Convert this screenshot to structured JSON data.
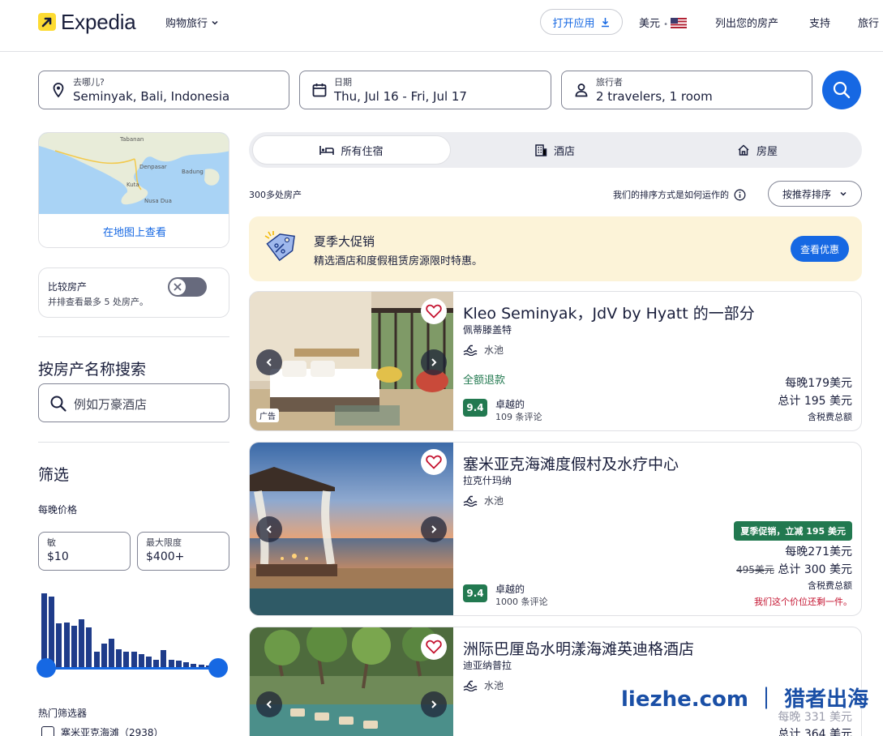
{
  "header": {
    "brand": "Expedia",
    "shop_travel": "购物旅行",
    "open_app": "打开应用",
    "currency": "美元",
    "list_property": "列出您的房产",
    "support": "支持",
    "trips": "旅行"
  },
  "search": {
    "destination_label": "去哪儿?",
    "destination_value": "Seminyak, Bali, Indonesia",
    "dates_label": "日期",
    "dates_value": "Thu, Jul 16 - Fri, Jul 17",
    "travelers_label": "旅行者",
    "travelers_value": "2 travelers, 1 room"
  },
  "sidebar": {
    "map_link": "在地图上查看",
    "map_labels": [
      "Tabanan",
      "Denpasar",
      "Kuta",
      "Nusa Dua",
      "Badung"
    ],
    "compare_title": "比较房产",
    "compare_sub": "并排查看最多 5 处房产。",
    "name_search_title": "按房产名称搜索",
    "name_search_placeholder": "例如万豪酒店",
    "filter_title": "筛选",
    "price_title": "每晚价格",
    "min_label": "敏",
    "min_value": "$10",
    "max_label": "最大限度",
    "max_value": "$400+",
    "histogram": [
      0.92,
      0.88,
      0.55,
      0.56,
      0.52,
      0.6,
      0.5,
      0.2,
      0.3,
      0.36,
      0.23,
      0.2,
      0.2,
      0.17,
      0.14,
      0.1,
      0.22,
      0.1,
      0.09,
      0.07,
      0.05,
      0.04,
      0.03
    ],
    "popular_filters_title": "热门筛选器",
    "popular_filter_1": "塞米亚克海滩（2938）"
  },
  "tabs": {
    "all": "所有住宿",
    "hotels": "酒店",
    "homes": "房屋"
  },
  "results": {
    "count": "300多处房产",
    "how_sort": "我们的排序方式是如何运作的",
    "sort_label": "按推荐排序"
  },
  "promo": {
    "title": "夏季大促销",
    "subtitle": "精选酒店和度假租赁房源限时特惠。",
    "button": "查看优惠"
  },
  "listings": [
    {
      "name": "Kleo Seminyak，JdV by Hyatt 的一部分",
      "location": "佩蒂滕盖特",
      "amenity": "水池",
      "refund": "全额退款",
      "rating": "9.4",
      "rating_word": "卓越的",
      "reviews": "109 条评论",
      "nightly": "每晚179美元",
      "total": "总计 195 美元",
      "tax_note": "含税费总额",
      "ad": "广告"
    },
    {
      "name": "塞米亚克海滩度假村及水疗中心",
      "location": "拉克什玛纳",
      "amenity": "水池",
      "deal": "夏季促销，立减 195 美元",
      "nightly": "每晚271美元",
      "old_price": "495美元",
      "total": "总计 300 美元",
      "tax_note": "含税费总额",
      "scarcity": "我们这个价位还剩一件。",
      "rating": "9.4",
      "rating_word": "卓越的",
      "reviews": "1000 条评论"
    },
    {
      "name": "洲际巴厘岛水明漾海滩英迪格酒店",
      "location": "迪亚纳普拉",
      "amenity": "水池",
      "nightly": "每晚 331 美元",
      "total": "总计 364 美元"
    }
  ],
  "watermark": "liezhe.com ｜ 猎者出海",
  "colors": {
    "brand_yellow": "#fddb32",
    "primary_blue": "#1668e3",
    "deal_green": "#227950",
    "scarcity_red": "#c4122f",
    "promo_bg": "#fcf3d8"
  }
}
